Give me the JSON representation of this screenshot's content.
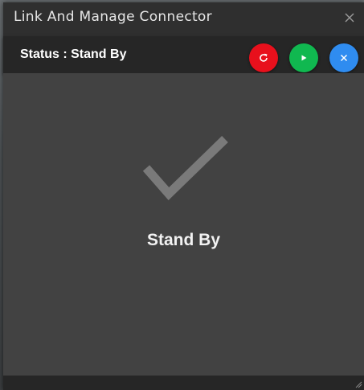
{
  "window": {
    "title": "Link And Manage Connector"
  },
  "status_bar": {
    "status_text": "Status : Stand By",
    "buttons": [
      {
        "name": "refresh",
        "icon": "refresh-icon",
        "color": "#e8101c"
      },
      {
        "name": "start",
        "icon": "play-icon",
        "color": "#10b850"
      },
      {
        "name": "stop",
        "icon": "close-icon",
        "color": "#2f8cf0"
      }
    ]
  },
  "main": {
    "state_icon": "checkmark-icon",
    "state_label": "Stand By"
  },
  "colors": {
    "window_bg": "#424242",
    "titlebar_bg": "#2f2f2f",
    "statusbar_bg": "#262626",
    "checkmark": "#7a7a7a"
  }
}
